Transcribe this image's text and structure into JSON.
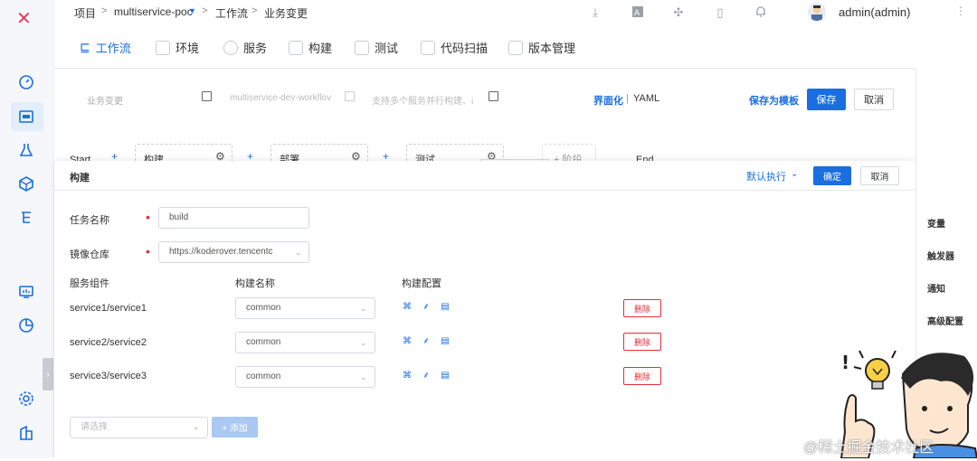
{
  "breadcrumb": {
    "project": "项目",
    "sep": ">",
    "service_project": "multiservice-poc",
    "workflow": "工作流",
    "current": "业务变更"
  },
  "user": {
    "name": "admin(admin)"
  },
  "tabs": [
    {
      "label": "工作流",
      "icon": "workflow-icon",
      "active": true
    },
    {
      "label": "环境",
      "icon": "environment-icon"
    },
    {
      "label": "服务",
      "icon": "service-icon"
    },
    {
      "label": "构建",
      "icon": "build-icon"
    },
    {
      "label": "测试",
      "icon": "test-icon"
    },
    {
      "label": "代码扫描",
      "icon": "scan-icon"
    },
    {
      "label": "版本管理",
      "icon": "version-icon"
    }
  ],
  "workflow": {
    "name": "业务变更",
    "key": "multiservice-dev-workflov",
    "description": "支持多个服务并行构建、i",
    "mode_gui": "界面化",
    "mode_sep": "|",
    "mode_yaml": "YAML",
    "save_template": "保存为模板",
    "save": "保存",
    "cancel": "取消"
  },
  "stages": {
    "start": "Start",
    "end": "End",
    "items": [
      "构建",
      "部署",
      "测试"
    ],
    "add_stage": "+ 阶段",
    "plus": "+"
  },
  "drawer": {
    "title": "构建",
    "exec_mode": "默认执行",
    "confirm": "确定",
    "cancel": "取消",
    "task_name_label": "任务名称",
    "task_name_value": "build",
    "repo_label": "镜像仓库",
    "repo_value": "https://koderover.tencentc",
    "col_service": "服务组件",
    "col_build_name": "构建名称",
    "col_build_config": "构建配置",
    "rows": [
      {
        "service": "service1/service1",
        "build": "common",
        "delete": "删除"
      },
      {
        "service": "service2/service2",
        "build": "common",
        "delete": "删除"
      },
      {
        "service": "service3/service3",
        "build": "common",
        "delete": "删除"
      }
    ],
    "select_placeholder": "请选择",
    "add_label": "+ 添加"
  },
  "right_panel": [
    "变量",
    "触发器",
    "通知",
    "高级配置"
  ],
  "watermark": "@稀土掘金技术社区",
  "colors": {
    "primary": "#1a6ee0",
    "danger": "#e0303a",
    "brand": "#e63b5a"
  }
}
